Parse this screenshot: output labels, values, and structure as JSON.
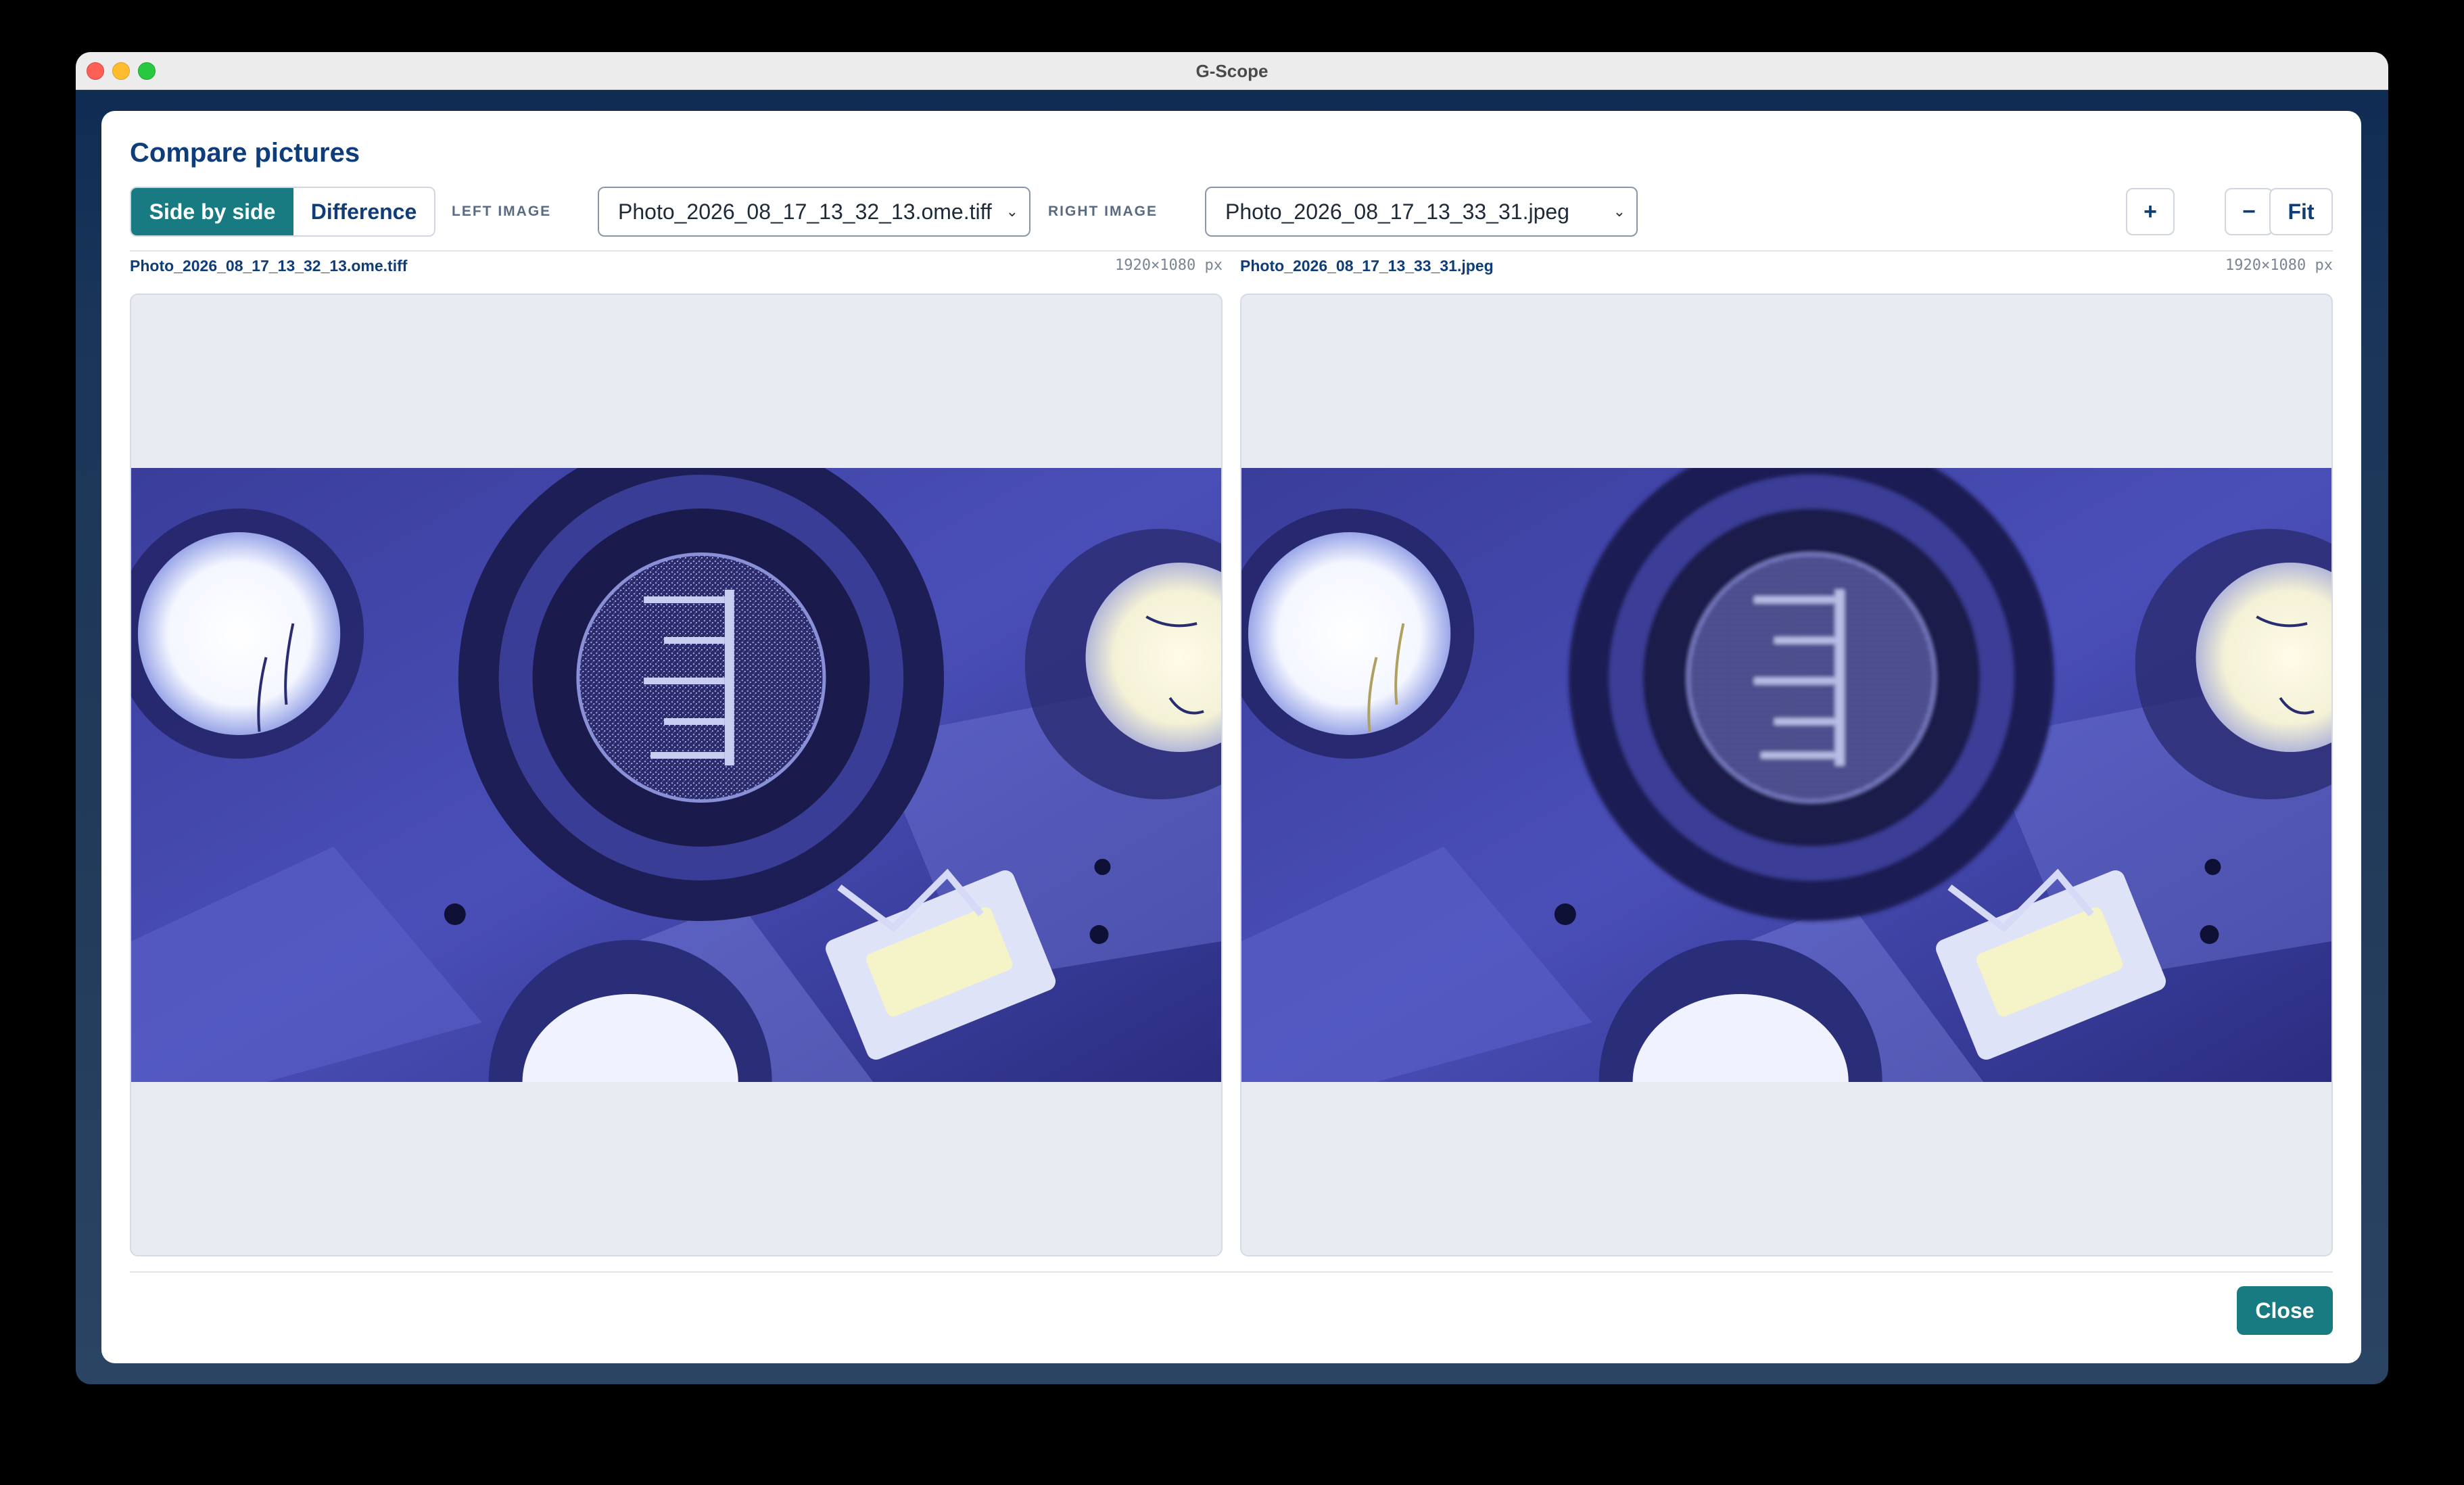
{
  "window": {
    "title": "G-Scope"
  },
  "dialog": {
    "title": "Compare pictures",
    "modes": {
      "side_by_side": "Side by side",
      "difference": "Difference",
      "active": "side_by_side"
    },
    "left_label": "LEFT IMAGE",
    "right_label": "RIGHT IMAGE",
    "left_select_value": "Photo_2026_08_17_13_32_13.ome.tiff",
    "right_select_value": "Photo_2026_08_17_13_33_31.jpeg",
    "zoom_in_label": "+",
    "zoom_out_label": "−",
    "fit_label": "Fit",
    "close_label": "Close"
  },
  "panels": {
    "left": {
      "filename": "Photo_2026_08_17_13_32_13.ome.tiff",
      "dimensions": "1920×1080 px"
    },
    "right": {
      "filename": "Photo_2026_08_17_13_33_31.jpeg",
      "dimensions": "1920×1080 px"
    }
  },
  "colors": {
    "accent": "#187b81",
    "title_text": "#0e3d7a",
    "viewer_bg": "#e8ecf2"
  }
}
